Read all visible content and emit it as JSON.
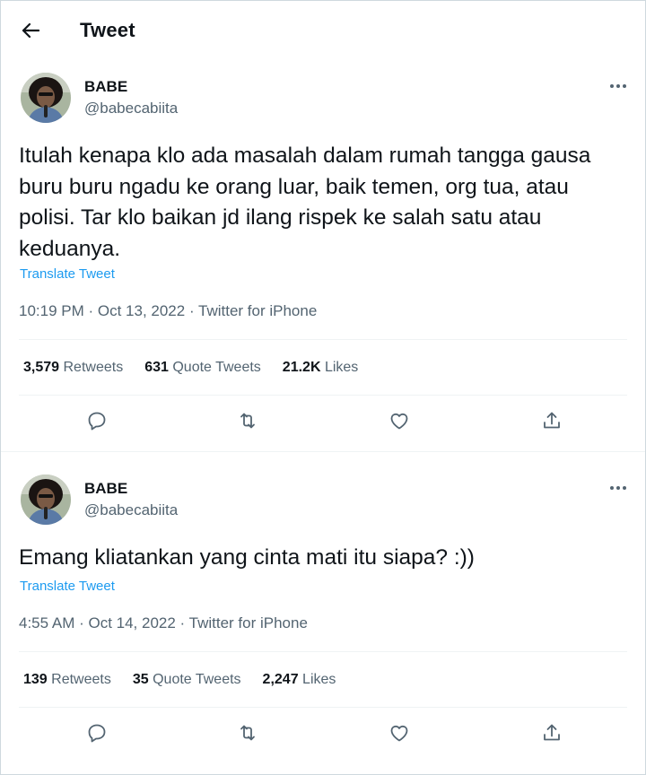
{
  "header": {
    "title": "Tweet",
    "back_icon": "arrow-left-icon"
  },
  "tweets": [
    {
      "author_name": "BABE",
      "author_handle": "@babecabiita",
      "text": "Itulah kenapa klo ada masalah dalam rumah tangga gausa buru buru ngadu ke orang luar, baik temen, org tua, atau polisi. Tar klo baikan jd ilang rispek ke salah satu atau keduanya.",
      "translate_label": "Translate Tweet",
      "meta": "10:19 PM · Oct 13, 2022 · Twitter for iPhone",
      "retweets_count": "3,579",
      "retweets_label": "Retweets",
      "quotes_count": "631",
      "quotes_label": "Quote Tweets",
      "likes_count": "21.2K",
      "likes_label": "Likes"
    },
    {
      "author_name": "BABE",
      "author_handle": "@babecabiita",
      "text": "Emang kliatankan yang cinta mati itu siapa? :))",
      "translate_label": "Translate Tweet",
      "meta": "4:55 AM · Oct 14, 2022 · Twitter for iPhone",
      "retweets_count": "139",
      "retweets_label": "Retweets",
      "quotes_count": "35",
      "quotes_label": "Quote Tweets",
      "likes_count": "2,247",
      "likes_label": "Likes"
    }
  ],
  "colors": {
    "link": "#1d9bf0",
    "secondary_text": "#536471",
    "primary_text": "#0f1419"
  },
  "icons": [
    "arrow-left-icon",
    "more-icon",
    "reply-icon",
    "retweet-icon",
    "like-icon",
    "share-icon"
  ]
}
